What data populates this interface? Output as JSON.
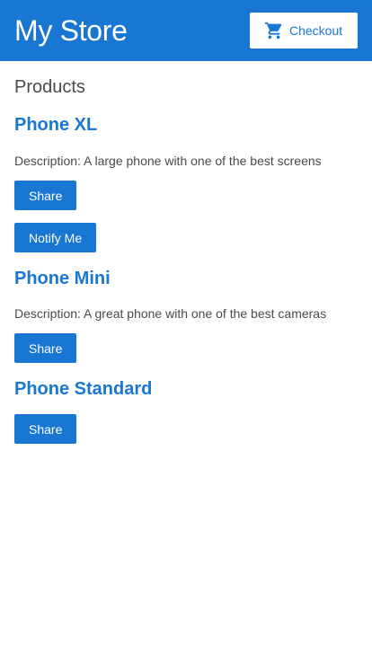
{
  "header": {
    "title": "My Store",
    "checkout_label": "Checkout",
    "checkout_icon": "shopping-cart-icon"
  },
  "main": {
    "heading": "Products",
    "products": [
      {
        "name": "Phone XL",
        "description": "Description: A large phone with one of the best screens",
        "share_label": "Share",
        "notify_label": "Notify Me"
      },
      {
        "name": "Phone Mini",
        "description": "Description: A great phone with one of the best cameras",
        "share_label": "Share"
      },
      {
        "name": "Phone Standard",
        "share_label": "Share"
      }
    ]
  },
  "colors": {
    "primary": "#1976d2",
    "text": "#4a4a4a",
    "background": "#ffffff"
  }
}
